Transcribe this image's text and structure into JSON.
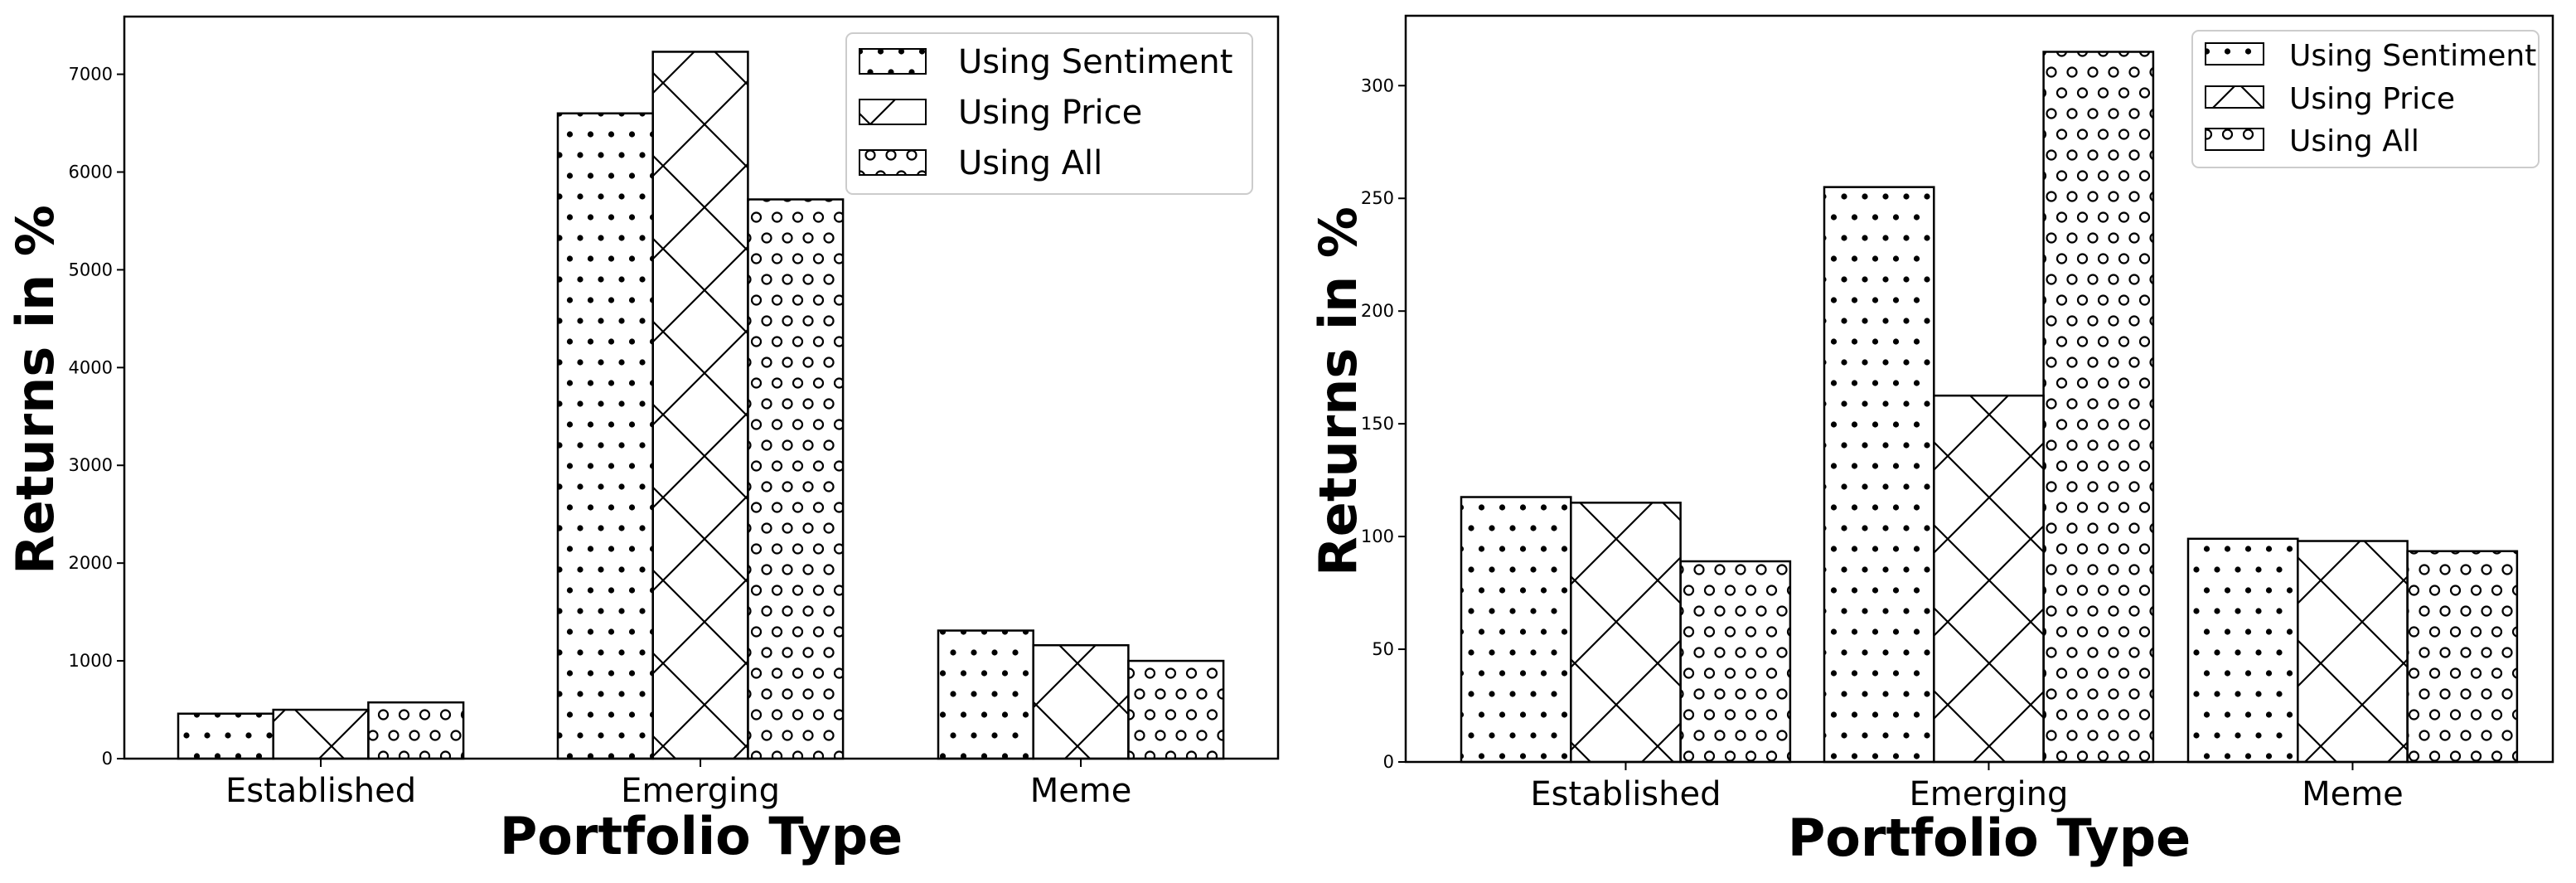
{
  "chart_data": [
    {
      "type": "bar",
      "title": "",
      "xlabel": "Portfolio Type",
      "ylabel": "Returns in %",
      "categories": [
        "Established",
        "Emerging",
        "Meme"
      ],
      "series": [
        {
          "name": "Using Sentiment",
          "hatch": "dots",
          "values": [
            460,
            6600,
            1310
          ]
        },
        {
          "name": "Using Price",
          "hatch": "cross",
          "values": [
            500,
            7230,
            1160
          ]
        },
        {
          "name": "Using All",
          "hatch": "circles",
          "values": [
            575,
            5720,
            1000
          ]
        }
      ],
      "yticks": [
        0,
        1000,
        2000,
        3000,
        4000,
        5000,
        6000,
        7000
      ],
      "ylim": [
        0,
        7590
      ],
      "grid": false,
      "legend": "top-right"
    },
    {
      "type": "bar",
      "title": "",
      "xlabel": "Portfolio Type",
      "ylabel": "Returns in %",
      "categories": [
        "Established",
        "Emerging",
        "Meme"
      ],
      "series": [
        {
          "name": "Using Sentiment",
          "hatch": "dots",
          "values": [
            117.5,
            255,
            99
          ]
        },
        {
          "name": "Using Price",
          "hatch": "cross",
          "values": [
            115,
            162.5,
            98
          ]
        },
        {
          "name": "Using All",
          "hatch": "circles",
          "values": [
            89,
            315,
            93.5
          ]
        }
      ],
      "yticks": [
        0,
        50,
        100,
        150,
        200,
        250,
        300
      ],
      "ylim": [
        0,
        331
      ],
      "grid": false,
      "legend": "top-right"
    }
  ],
  "colors": {
    "bar_fill": "#ffffff",
    "edge": "#000000",
    "legend_frame": "#cccccc"
  }
}
